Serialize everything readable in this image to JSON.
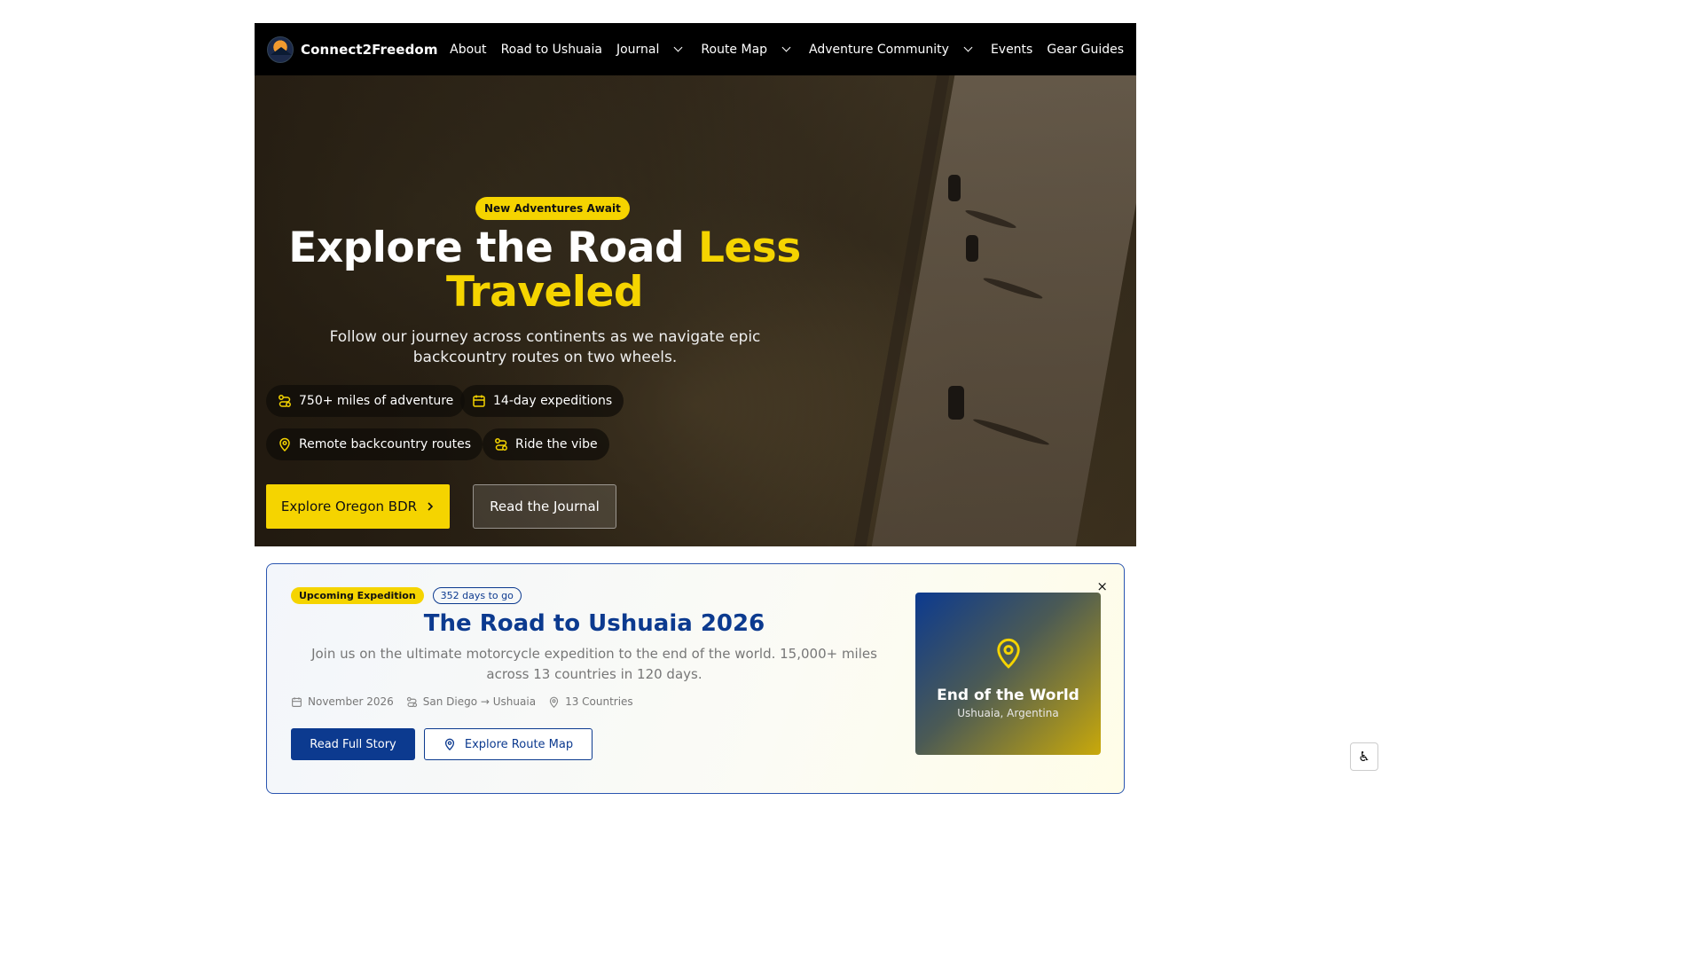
{
  "nav": {
    "brand": "Connect2Freedom",
    "items": [
      {
        "label": "About",
        "dropdown": false
      },
      {
        "label": "Road to Ushuaia",
        "dropdown": false
      },
      {
        "label": "Journal",
        "dropdown": true
      },
      {
        "label": "Route Map",
        "dropdown": true
      },
      {
        "label": "Adventure Community",
        "dropdown": true
      },
      {
        "label": "Events",
        "dropdown": false
      },
      {
        "label": "Gear Guides",
        "dropdown": false
      }
    ]
  },
  "hero": {
    "badge": "New Adventures Await",
    "title_main": "Explore the Road",
    "title_accent": "Less Traveled",
    "subtitle": "Follow our journey across continents as we navigate epic backcountry routes on two wheels.",
    "pills": [
      {
        "icon": "route-icon",
        "label": "750+ miles of adventure"
      },
      {
        "icon": "calendar-icon",
        "label": "14-day expeditions"
      },
      {
        "icon": "map-pin-icon",
        "label": "Remote backcountry routes"
      },
      {
        "icon": "route-icon",
        "label": "Ride the vibe"
      }
    ],
    "primary_button": "Explore Oregon BDR",
    "secondary_button": "Read the Journal"
  },
  "expedition": {
    "tag": "Upcoming Expedition",
    "countdown": "352 days to go",
    "title": "The Road to Ushuaia 2026",
    "description": "Join us on the ultimate motorcycle expedition to the end of the world. 15,000+ miles across 13 countries in 120 days.",
    "meta": {
      "date": "November 2026",
      "route": "San Diego → Ushuaia",
      "countries": "13 Countries"
    },
    "primary_button": "Read Full Story",
    "secondary_button": "Explore Route Map",
    "close": "×",
    "destination_title": "End of the World",
    "destination_subtitle": "Ushuaia, Argentina"
  },
  "colors": {
    "accent_yellow": "#f5d400",
    "brand_blue": "#0c3a8f",
    "nav_bg": "#000000"
  }
}
